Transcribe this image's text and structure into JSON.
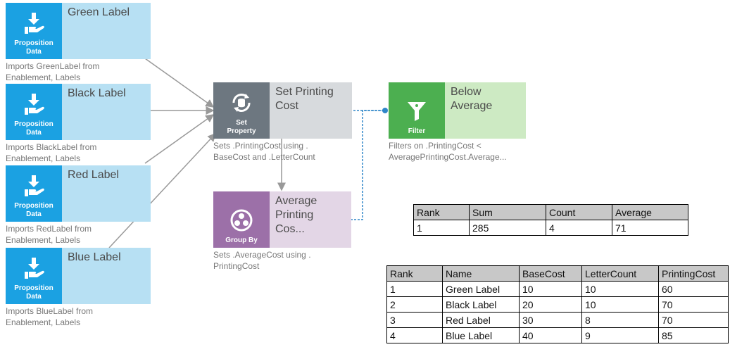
{
  "nodes": {
    "green": {
      "icon_caption": [
        "Proposition",
        "Data"
      ],
      "title": "Green Label",
      "desc": [
        "Imports GreenLabel from",
        "Enablement, Labels"
      ]
    },
    "black": {
      "icon_caption": [
        "Proposition",
        "Data"
      ],
      "title": "Black Label",
      "desc": [
        "Imports BlackLabel from",
        "Enablement, Labels"
      ]
    },
    "red": {
      "icon_caption": [
        "Proposition",
        "Data"
      ],
      "title": "Red Label",
      "desc": [
        "Imports RedLabel from",
        "Enablement, Labels"
      ]
    },
    "blue": {
      "icon_caption": [
        "Proposition",
        "Data"
      ],
      "title": "Blue Label",
      "desc": [
        "Imports BlueLabel from",
        "Enablement, Labels"
      ]
    },
    "setprop": {
      "icon_caption": [
        "Set",
        "Property"
      ],
      "title": [
        "Set Printing",
        "Cost"
      ],
      "desc": [
        "Sets .PrintingCost using .",
        "BaseCost and .LetterCount"
      ]
    },
    "filter": {
      "icon_caption": [
        "Filter"
      ],
      "title": [
        "Below",
        "Average"
      ],
      "desc": [
        "Filters on .PrintingCost <",
        "AveragePrintingCost.Average..."
      ]
    },
    "groupby": {
      "icon_caption": [
        "Group By"
      ],
      "title": [
        "Average",
        "Printing Cos..."
      ],
      "desc": [
        "Sets .AverageCost using .",
        "PrintingCost"
      ]
    }
  },
  "colors": {
    "proposition": "#1ba1e2",
    "setprop": "#6d7780",
    "filter": "#4caf50",
    "groupby": "#9c70a8",
    "connector": "#999999",
    "dashed": "#2f86c8"
  },
  "summary_table": {
    "headers": [
      "Rank",
      "Sum",
      "Count",
      "Average"
    ],
    "rows": [
      [
        "1",
        "285",
        "4",
        "71"
      ]
    ]
  },
  "detail_table": {
    "headers": [
      "Rank",
      "Name",
      "BaseCost",
      "LetterCount",
      "PrintingCost"
    ],
    "rows": [
      [
        "1",
        "Green Label",
        "10",
        "10",
        "60"
      ],
      [
        "2",
        "Black Label",
        "20",
        "10",
        "70"
      ],
      [
        "3",
        "Red Label",
        "30",
        "8",
        "70"
      ],
      [
        "4",
        "Blue Label",
        "40",
        "9",
        "85"
      ]
    ]
  }
}
